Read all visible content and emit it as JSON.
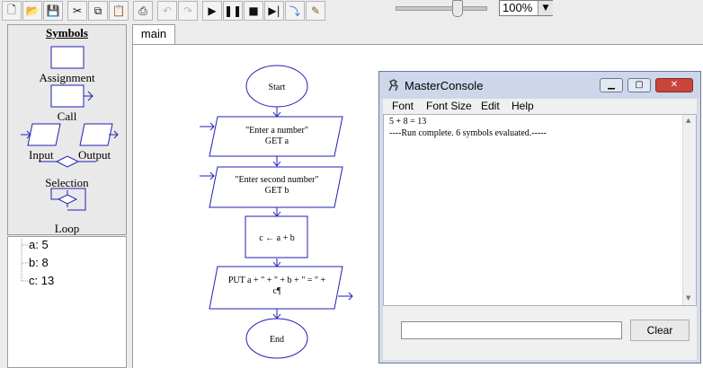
{
  "toolbar": {
    "buttons": [
      {
        "name": "new-file",
        "icon": "new-file-icon"
      },
      {
        "name": "open-folder",
        "icon": "open-folder-icon"
      },
      {
        "name": "save",
        "icon": "save-icon"
      },
      {
        "name": "cut",
        "icon": "cut-icon"
      },
      {
        "name": "copy",
        "icon": "copy-icon"
      },
      {
        "name": "paste",
        "icon": "paste-icon"
      },
      {
        "name": "print",
        "icon": "print-icon"
      },
      {
        "name": "undo",
        "icon": "undo-icon"
      },
      {
        "name": "redo",
        "icon": "redo-icon"
      },
      {
        "name": "run",
        "icon": "play-icon"
      },
      {
        "name": "pause",
        "icon": "pause-icon"
      },
      {
        "name": "stop",
        "icon": "stop-icon"
      },
      {
        "name": "step",
        "icon": "step-icon"
      },
      {
        "name": "step-into",
        "icon": "step-into-icon"
      },
      {
        "name": "pen",
        "icon": "pen-icon"
      }
    ],
    "zoom": "100%",
    "speed_slider_level": 0.66
  },
  "symbols_panel": {
    "title": "Symbols",
    "assignment": "Assignment",
    "call": "Call",
    "input": "Input",
    "output": "Output",
    "selection": "Selection",
    "loop": "Loop"
  },
  "variables": [
    "a: 5",
    "b: 8",
    "c: 13"
  ],
  "tab": "main",
  "flowchart": {
    "start": "Start",
    "input1_line1": "\"Enter a number\"",
    "input1_line2": "GET a",
    "input2_line1": "\"Enter second number\"",
    "input2_line2": "GET b",
    "assign": "c ← a + b",
    "output_line1": "PUT a + \" + \" + b + \" = \" +",
    "output_line2": "c¶",
    "end": "End"
  },
  "console": {
    "title": "MasterConsole",
    "menu": [
      "Font",
      "Font Size",
      "Edit",
      "Help"
    ],
    "output": [
      "5 + 8 = 13",
      "----Run complete.  6 symbols evaluated.-----"
    ],
    "input_value": "",
    "clear_label": "Clear"
  },
  "colors": {
    "flow_stroke": "#1f1fb8",
    "console_titlebar": "#cdd6ea",
    "close_button": "#c8453a"
  }
}
